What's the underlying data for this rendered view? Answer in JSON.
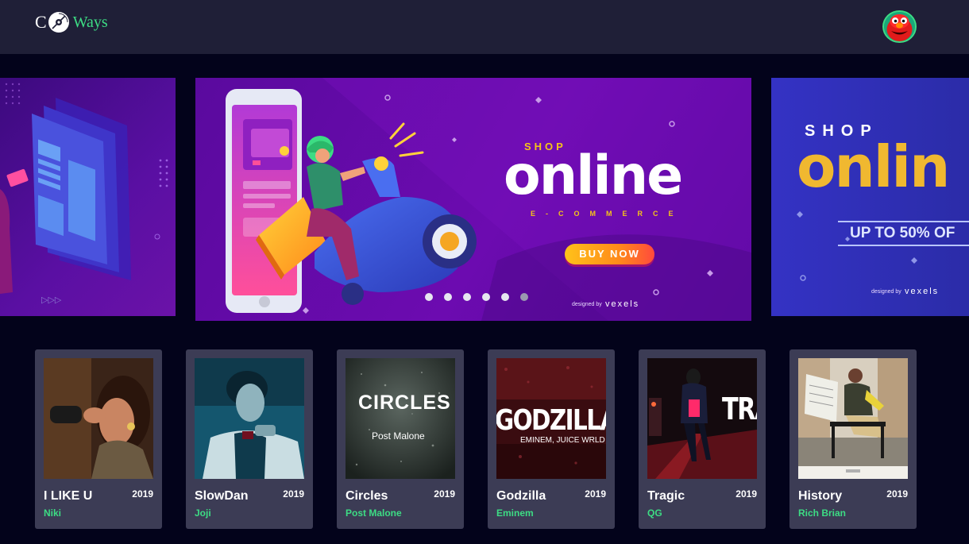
{
  "brand": {
    "logo_prefix": "C",
    "logo_suffix": "Ways",
    "accent": "#3ddc84",
    "header_bg": "#1f1f37",
    "page_bg": "#03031b"
  },
  "header": {
    "avatar_icon": "user-avatar-icon"
  },
  "carousel": {
    "main": {
      "shop": "SHOP",
      "online": "online",
      "ecommerce": "E-COMMERCE",
      "buy_now": "BUY NOW",
      "designed_by": "designed by",
      "vexels": "vexels"
    },
    "right": {
      "shop": "SHOP",
      "online": "onlin",
      "offer": "UP TO 50% OF",
      "designed_by": "designed by",
      "vexels": "vexels"
    },
    "dots": {
      "count": 6,
      "active_index": 0
    }
  },
  "albums": [
    {
      "title": "I LIKE U",
      "year": "2019",
      "artist": "Niki",
      "cover_text": ""
    },
    {
      "title": "SlowDan",
      "year": "2019",
      "artist": "Joji",
      "cover_text": ""
    },
    {
      "title": "Circles",
      "year": "2019",
      "artist": "Post Malone",
      "cover_text": "CIRCLES",
      "cover_sub": "Post Malone"
    },
    {
      "title": "Godzilla",
      "year": "2019",
      "artist": "Eminem",
      "cover_text": "GODZILLA",
      "cover_sub": "EMINEM, JUICE WRLD"
    },
    {
      "title": "Tragic",
      "year": "2019",
      "artist": "QG",
      "cover_text": "TRA"
    },
    {
      "title": "History",
      "year": "2019",
      "artist": "Rich Brian",
      "cover_text": ""
    }
  ]
}
